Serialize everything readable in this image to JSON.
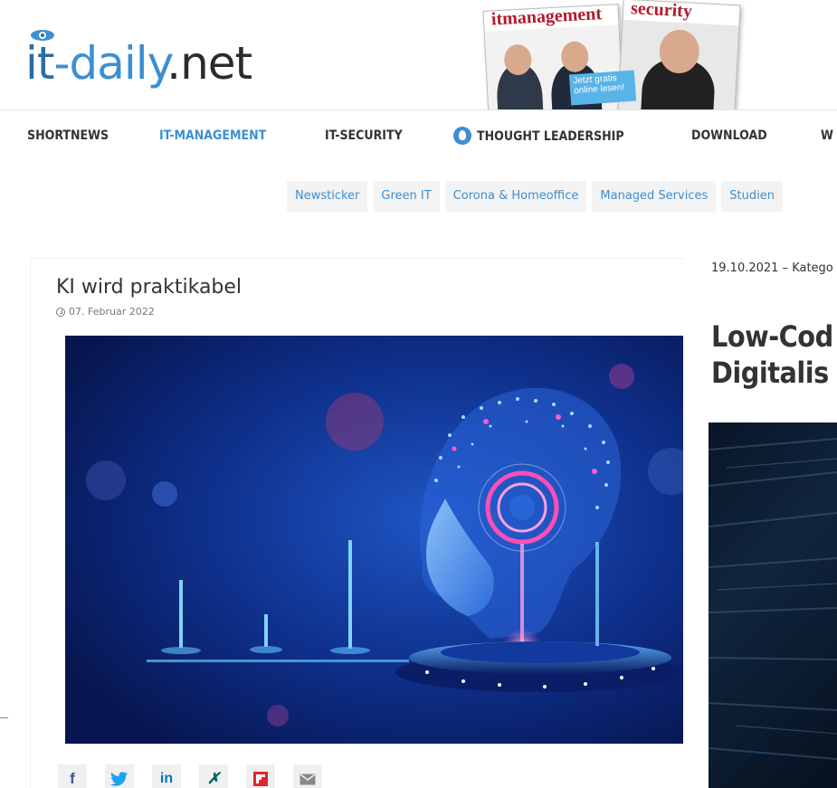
{
  "header": {
    "logo": {
      "part_it": "it",
      "part_daily": "-daily",
      "part_net": ".net"
    },
    "magazines": {
      "mag1_title": "itmanagement",
      "mag2_title": "security",
      "badge": "Jetzt gratis online lesen!"
    }
  },
  "nav": {
    "items": [
      {
        "label": "SHORTNEWS"
      },
      {
        "label": "IT-MANAGEMENT"
      },
      {
        "label": "IT-SECURITY"
      },
      {
        "label": "THOUGHT LEADERSHIP"
      },
      {
        "label": "DOWNLOAD"
      },
      {
        "label": "W"
      }
    ],
    "active_color": "#3d8fd1"
  },
  "subnav": {
    "items": [
      {
        "label": "Newsticker"
      },
      {
        "label": "Green IT"
      },
      {
        "label": "Corona & Homeoffice"
      },
      {
        "label": "Managed Services"
      },
      {
        "label": "Studien"
      }
    ]
  },
  "article_left": {
    "title": "KI wird praktikabel",
    "date": "07. Februar 2022",
    "share": [
      "f",
      "t",
      "in",
      "x",
      "F",
      "mail"
    ]
  },
  "article_right": {
    "meta": "19.10.2021 – Katego",
    "title_line1": "Low-Cod",
    "title_line2": "Digitalis"
  },
  "colors": {
    "brand_blue": "#3d8fd1",
    "dark_blue": "#2b6ca3",
    "facebook": "#3b5998",
    "twitter": "#1da1f2",
    "linkedin": "#0077b5",
    "xing": "#026466",
    "flipboard": "#e12828"
  }
}
